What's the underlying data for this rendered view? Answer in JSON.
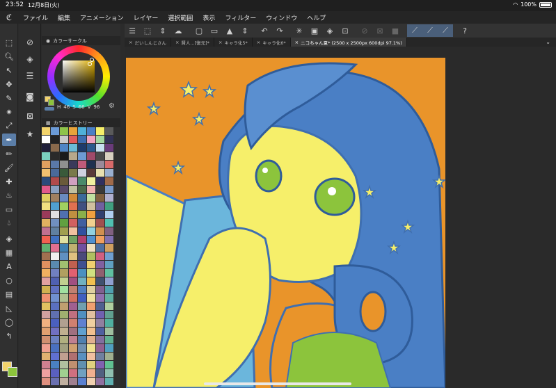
{
  "status_bar": {
    "time": "23:52",
    "date": "12月8日(火)",
    "battery": "100%"
  },
  "menu": [
    "ファイル",
    "編集",
    "アニメーション",
    "レイヤー",
    "選択範囲",
    "表示",
    "フィルター",
    "ウィンドウ",
    "ヘルプ"
  ],
  "color_panel": {
    "title": "カラーサークル",
    "h_label": "H",
    "h": "46",
    "s_label": "S",
    "s": "66",
    "v_label": "V",
    "v": "96"
  },
  "history_panel": {
    "title": "カラーヒストリー"
  },
  "tabs": [
    {
      "label": "だいしんじさん"
    },
    {
      "label": "賢人...[復元]*"
    },
    {
      "label": "キャラ化5*"
    },
    {
      "label": "キャラ化6*"
    },
    {
      "label": "ニコちゃん夏* (2500 x 2500px 600dpi 97.1%)"
    }
  ],
  "colors": {
    "accent": "#5b7ea8",
    "art_orange": "#e9942a",
    "art_blue": "#4a7fc5",
    "art_yellow": "#f6ef6a",
    "art_green": "#8cc43c",
    "current_color": "#f2d36b"
  },
  "swatches": [
    "#f2d36b",
    "#6b9ad6",
    "#8ec34a",
    "#e9a33a",
    "#4fb0d8",
    "#4a7fc5",
    "#f6ef6a",
    "#5a5a5a",
    "#ffffff",
    "#222222",
    "#c9c9c9",
    "#e05b5b",
    "#3c6db0",
    "#f1a4c1",
    "#a3d8a0",
    "#333355",
    "#20203a",
    "#8a6a4c",
    "#4f85c5",
    "#6bbad7",
    "#1d3b6b",
    "#2c5a8c",
    "#c8e0f0",
    "#6a3b7a",
    "#7ad0c0",
    "#2a2a2a",
    "#1a1a1a",
    "#b7a88c",
    "#6d9bd4",
    "#a04a6a",
    "#4a4a4a",
    "#d8d0c0",
    "#e0a060",
    "#5a78a8",
    "#909090",
    "#3a3a5a",
    "#c05a7a",
    "#1f2f4f",
    "#9a8a9a",
    "#d86a6a",
    "#f0c070",
    "#4a6a9a",
    "#3a5a3a",
    "#7a7a4a",
    "#d0d0e0",
    "#5a3a3a",
    "#e8e0b0",
    "#9ab0d0",
    "#2a4a7a",
    "#b04a4a",
    "#6a5a3a",
    "#d0a0c0",
    "#4a8a6a",
    "#f0f0a0",
    "#303060",
    "#a06a4a",
    "#e05a8a",
    "#8aa0c0",
    "#5a4a6a",
    "#c0c0a0",
    "#4a6a4a",
    "#f0b0b0",
    "#3a3a3a",
    "#7a9aca",
    "#e0d060",
    "#a08060",
    "#6a8ac0",
    "#d08a3a",
    "#3a6a9a",
    "#c0e0a0",
    "#806040",
    "#b0b0d0",
    "#f0e080",
    "#50a0d0",
    "#a0d060",
    "#e07050",
    "#405080",
    "#d0c0a0",
    "#7060a0",
    "#40a080",
    "#9a3a5a",
    "#e0e0e0",
    "#5070b0",
    "#c09040",
    "#8ab04a",
    "#f0a040",
    "#304070",
    "#b0d0f0",
    "#e0b060",
    "#7090c0",
    "#60a040",
    "#d06060",
    "#4060a0",
    "#f0d090",
    "#a05050",
    "#50c0b0",
    "#c07090",
    "#6080a0",
    "#a0a050",
    "#f0c0a0",
    "#3050a0",
    "#90d0e0",
    "#d09050",
    "#806080",
    "#f06050",
    "#4070c0",
    "#e0e0a0",
    "#70a060",
    "#b04070",
    "#5090d0",
    "#f0a060",
    "#8070b0",
    "#60b070",
    "#e07090",
    "#4080b0",
    "#c0b070",
    "#7050a0",
    "#f0e0c0",
    "#5070a0",
    "#d0a060",
    "#a07050",
    "#f0f0f0",
    "#6090c0",
    "#e0c080",
    "#4a4a7a",
    "#b0c060",
    "#d06080",
    "#70a0d0",
    "#e09060",
    "#5a8ab0",
    "#a0c070",
    "#c06050",
    "#405090",
    "#f0d070",
    "#8060a0",
    "#60a0c0",
    "#f0b060",
    "#7080c0",
    "#b0a060",
    "#e06070",
    "#4a90c0",
    "#d0e080",
    "#906070",
    "#60c0a0",
    "#e0a0a0",
    "#5060b0",
    "#c0d090",
    "#a05080",
    "#70b0c0",
    "#f0c050",
    "#405070",
    "#90a0d0",
    "#d0b050",
    "#6070c0",
    "#a0e0a0",
    "#c08070",
    "#5080c0",
    "#e0d0a0",
    "#806090",
    "#50a0b0",
    "#f09070",
    "#7090d0",
    "#b0c090",
    "#d07060",
    "#4060c0",
    "#f0e0a0",
    "#9070b0",
    "#60b0a0",
    "#e0c060",
    "#5a70c0",
    "#c0a070",
    "#a06090",
    "#70a0b0",
    "#f0a070",
    "#506090",
    "#b0d0a0",
    "#d0a0a0",
    "#6070b0",
    "#a0b070",
    "#c07080",
    "#5090c0",
    "#e0c0a0",
    "#7060b0",
    "#60a090",
    "#f0b080",
    "#4a60c0",
    "#b0a090",
    "#d08070",
    "#6080d0",
    "#f0d0a0",
    "#9080a0",
    "#50b0a0",
    "#e0a070",
    "#7070c0",
    "#c0b090",
    "#a07080",
    "#60a0d0",
    "#f0c090",
    "#5060a0",
    "#a0c0a0",
    "#d09070",
    "#6a80c0",
    "#b0b080",
    "#c08090",
    "#5080b0",
    "#e0b090",
    "#8070a0",
    "#60b090",
    "#f0a090",
    "#4a70c0",
    "#a0a080",
    "#d0a070",
    "#7090b0",
    "#f0e090",
    "#906090",
    "#50a0c0",
    "#e0b070",
    "#6070d0",
    "#c0a090",
    "#b07070",
    "#5a90c0",
    "#f0c0a0",
    "#7080a0",
    "#a0b090",
    "#d08090",
    "#4a80c0",
    "#b0c0a0",
    "#c09070",
    "#6090b0",
    "#e0d080",
    "#8060b0",
    "#60c090",
    "#f0a0a0",
    "#5a60c0",
    "#a0d090",
    "#d07080",
    "#70a0c0",
    "#f0b090",
    "#506080",
    "#90c0b0",
    "#e09080",
    "#6a70b0",
    "#c0b0a0",
    "#a08090",
    "#5a80d0",
    "#f0d0b0",
    "#9070a0",
    "#60b0b0",
    "#d0b070",
    "#4a70b0",
    "#b0a0a0",
    "#c0a080",
    "#6a90d0",
    "#e0c0b0",
    "#8080b0",
    "#70b0a0",
    "#f09080",
    "#5a70b0",
    "#a0c090",
    "#d09080",
    "#4a90b0",
    "#f0e0b0",
    "#a07090",
    "#60a0a0",
    "#e0a080",
    "#6a60b0",
    "#c0c0a0",
    "#b08080",
    "#5a80b0",
    "#f0c0b0",
    "#7a70a0",
    "#a0b0a0",
    "#d0a080",
    "#4a80b0",
    "#b0b0a0",
    "#c09080",
    "#6a80b0",
    "#e0d0b0",
    "#8a70a0",
    "#70a0a0"
  ]
}
